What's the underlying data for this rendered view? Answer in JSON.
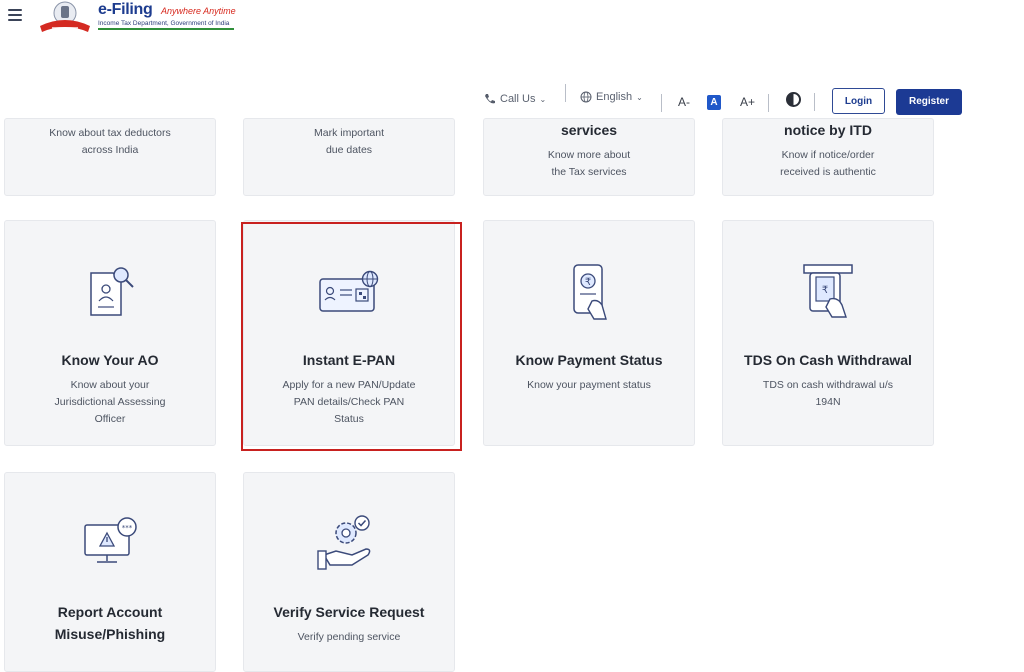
{
  "header": {
    "brand_title": "e-Filing",
    "brand_tagline": "Anywhere Anytime",
    "brand_subtitle": "Income Tax Department, Government of India",
    "call_us": "Call Us",
    "language": "English",
    "font_decrease": "A-",
    "font_default": "A",
    "font_increase": "A+",
    "login": "Login",
    "register": "Register"
  },
  "cards_top": [
    {
      "title": "",
      "desc_lines": [
        "Know about tax deductors",
        "across India"
      ]
    },
    {
      "title": "",
      "desc_lines": [
        "Mark important",
        "due dates"
      ]
    },
    {
      "title": "services",
      "desc_lines": [
        "Know more about",
        "the Tax services"
      ]
    },
    {
      "title": "notice by ITD",
      "desc_lines": [
        "Know if notice/order",
        "received is authentic"
      ]
    }
  ],
  "cards_middle": [
    {
      "title": "Know Your AO",
      "desc_lines": [
        "Know about your",
        "Jurisdictional Assessing",
        "Officer"
      ],
      "icon": "document-search-icon"
    },
    {
      "title": "Instant E-PAN",
      "desc_lines": [
        "Apply for a new PAN/Update",
        "PAN details/Check PAN",
        "Status"
      ],
      "icon": "pan-card-globe-icon"
    },
    {
      "title": "Know Payment Status",
      "desc_lines": [
        "Know your payment status"
      ],
      "icon": "phone-payment-icon"
    },
    {
      "title": "TDS On Cash Withdrawal",
      "desc_lines": [
        "TDS on cash withdrawal u/s",
        "194N"
      ],
      "icon": "atm-withdrawal-icon"
    }
  ],
  "cards_bottom": [
    {
      "title_lines": [
        "Report Account",
        "Misuse/Phishing"
      ],
      "desc_lines": [],
      "icon": "monitor-warning-icon"
    },
    {
      "title_lines": [
        "Verify Service Request"
      ],
      "desc_lines": [
        "Verify pending service"
      ],
      "icon": "hand-gear-check-icon"
    }
  ],
  "colors": {
    "brand_blue": "#1c3a94",
    "highlight_red": "#c8211f",
    "card_bg": "#f4f5f7",
    "accent": "#2058c9"
  }
}
